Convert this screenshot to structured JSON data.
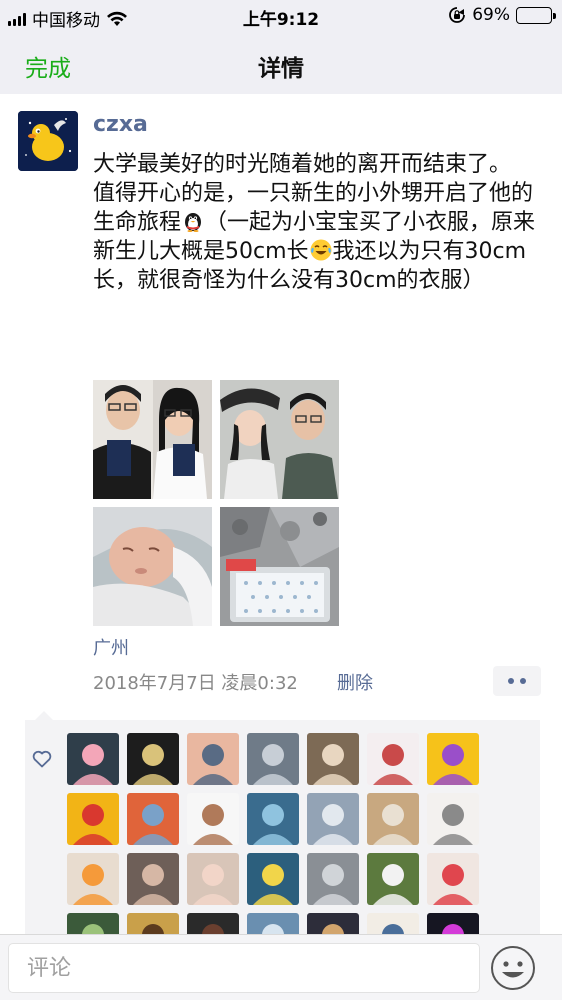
{
  "status_bar": {
    "carrier": "中国移动",
    "time": "上午9:12",
    "battery_percent": "69%",
    "battery_level": 0.69,
    "battery_color": "#f5c518"
  },
  "navbar": {
    "done_label": "完成",
    "title": "详情"
  },
  "post": {
    "username": "czxa",
    "text_part1": "大学最美好的时光随着她的离开而结束了。\n值得开心的是，一只新生的小外甥开启了他的生命旅程",
    "emoji1": "penguin-icon",
    "text_part2": "（一起为小宝宝买了小衣服，原来新生儿大概是50cm长",
    "emoji2": "crying-laughing-icon",
    "text_part3": "我还以为只有30cm长，就很奇怪为什么没有30cm的衣服）",
    "photos": [
      {
        "name": "photo-couple-passports",
        "icon": "photo"
      },
      {
        "name": "photo-couple-selfie",
        "icon": "photo"
      },
      {
        "name": "photo-newborn-baby",
        "icon": "photo"
      },
      {
        "name": "photo-baby-clothes",
        "icon": "photo"
      }
    ],
    "location": "广州",
    "timestamp": "2018年7月7日 凌晨0:32",
    "delete_label": "删除",
    "more_icon": "more-dots-icon"
  },
  "likes": {
    "icon": "heart-outline-icon",
    "avatars_count_visible": 28
  },
  "comment_bar": {
    "placeholder": "评论",
    "emoji_button_icon": "smiley-face-icon"
  },
  "colors": {
    "link_blue": "#576b95",
    "accent_green": "#1aad19",
    "bar_gray": "#efeff4",
    "likes_bg": "#f3f3f5"
  }
}
